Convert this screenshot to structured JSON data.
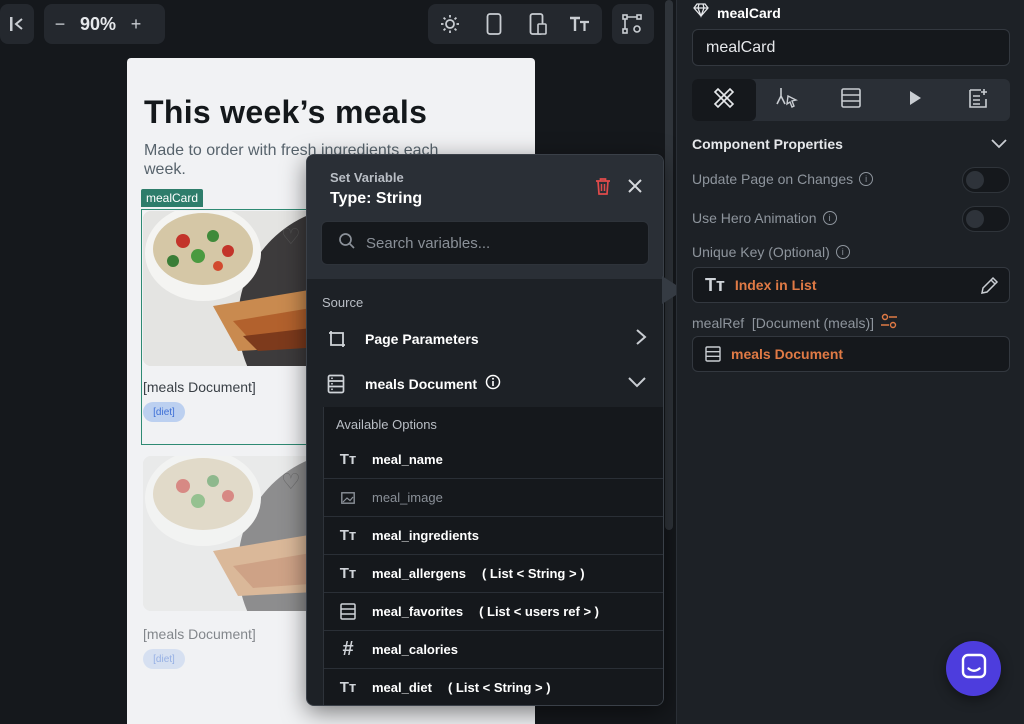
{
  "toolbar": {
    "zoom": "90%",
    "zoom_out": "−",
    "zoom_in": "+"
  },
  "preview": {
    "title": "This week’s meals",
    "subtitle": "Made to order with fresh ingredients each week.",
    "card_tag": "mealCard",
    "cards": [
      {
        "doc_label": "[meals Document]",
        "chip": "[diet]"
      },
      {
        "doc_label": "[meals Document]",
        "chip": "[diet]"
      }
    ]
  },
  "popup": {
    "heading": "Set Variable",
    "type_label": "Type: String",
    "search_placeholder": "Search variables...",
    "source_label": "Source",
    "sources": [
      {
        "label": "Page Parameters",
        "icon": "bracket-icon"
      },
      {
        "label": "meals Document",
        "icon": "database-icon"
      }
    ],
    "options_title": "Available Options",
    "options": [
      {
        "name": "meal_name",
        "type": "",
        "icon": "text-type-icon",
        "enabled": true
      },
      {
        "name": "meal_image",
        "type": "",
        "icon": "image-icon",
        "enabled": false
      },
      {
        "name": "meal_ingredients",
        "type": "",
        "icon": "text-type-icon",
        "enabled": true
      },
      {
        "name": "meal_allergens",
        "type": "( List < String > )",
        "icon": "text-type-icon",
        "enabled": true
      },
      {
        "name": "meal_favorites",
        "type": "( List < users ref > )",
        "icon": "database-icon",
        "enabled": true
      },
      {
        "name": "meal_calories",
        "type": "",
        "icon": "hash-icon",
        "enabled": true
      },
      {
        "name": "meal_diet",
        "type": "( List < String > )",
        "icon": "text-type-icon",
        "enabled": true
      }
    ]
  },
  "panel": {
    "component_name": "mealCard",
    "name_input_value": "mealCard",
    "section_title": "Component Properties",
    "update_page_label": "Update Page on Changes",
    "hero_label": "Use Hero Animation",
    "unique_key_label": "Unique Key (Optional)",
    "unique_key_value": "Index in List",
    "meal_ref_label": "mealRef  [Document (meals)]",
    "meal_ref_value": "meals Document"
  },
  "colors": {
    "accent_orange": "#e07a45",
    "delete_red": "#e14b4b",
    "chat_purple": "#4d3ddd",
    "tag_green": "#2e7d6b"
  }
}
